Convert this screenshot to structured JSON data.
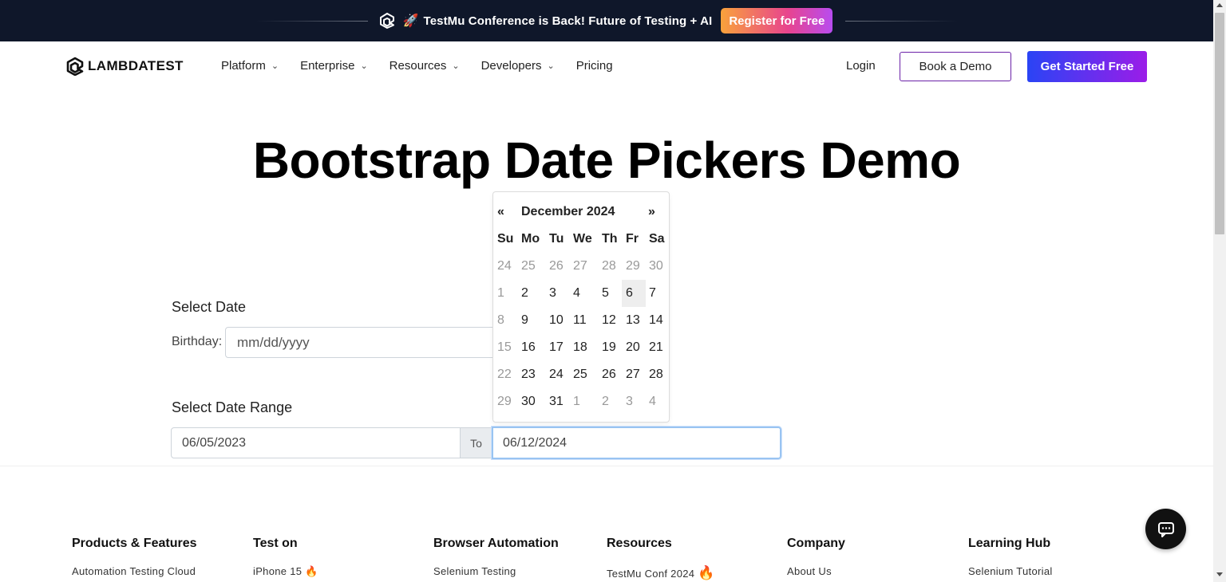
{
  "announcement": {
    "rocket": "🚀",
    "text": "TestMu Conference is Back! Future of Testing + AI",
    "cta": "Register for Free"
  },
  "header": {
    "brand": "LAMBDATEST",
    "nav": [
      {
        "label": "Platform",
        "dropdown": true
      },
      {
        "label": "Enterprise",
        "dropdown": true
      },
      {
        "label": "Resources",
        "dropdown": true
      },
      {
        "label": "Developers",
        "dropdown": true
      },
      {
        "label": "Pricing",
        "dropdown": false
      }
    ],
    "login": "Login",
    "book_demo": "Book a Demo",
    "get_started": "Get Started Free"
  },
  "main": {
    "title": "Bootstrap Date Pickers Demo",
    "select_date_label": "Select Date",
    "birthday_label": "Birthday:",
    "birthday_placeholder": "mm/dd/yyyy",
    "select_range_label": "Select Date Range",
    "range_from": "06/05/2023",
    "range_to_label": "To",
    "range_to": "06/12/2024"
  },
  "datepicker": {
    "prev": "«",
    "title": "December 2024",
    "next": "»",
    "weekdays": [
      "Su",
      "Mo",
      "Tu",
      "We",
      "Th",
      "Fr",
      "Sa"
    ],
    "weeks": [
      [
        {
          "d": "24",
          "old": true
        },
        {
          "d": "25",
          "old": true
        },
        {
          "d": "26",
          "old": true
        },
        {
          "d": "27",
          "old": true
        },
        {
          "d": "28",
          "old": true
        },
        {
          "d": "29",
          "old": true
        },
        {
          "d": "30",
          "old": true
        }
      ],
      [
        {
          "d": "1",
          "old": true
        },
        {
          "d": "2"
        },
        {
          "d": "3"
        },
        {
          "d": "4"
        },
        {
          "d": "5"
        },
        {
          "d": "6",
          "highlight": true
        },
        {
          "d": "7"
        }
      ],
      [
        {
          "d": "8",
          "old": true
        },
        {
          "d": "9"
        },
        {
          "d": "10"
        },
        {
          "d": "11"
        },
        {
          "d": "12"
        },
        {
          "d": "13"
        },
        {
          "d": "14"
        }
      ],
      [
        {
          "d": "15",
          "old": true
        },
        {
          "d": "16"
        },
        {
          "d": "17"
        },
        {
          "d": "18"
        },
        {
          "d": "19"
        },
        {
          "d": "20"
        },
        {
          "d": "21"
        }
      ],
      [
        {
          "d": "22",
          "old": true
        },
        {
          "d": "23"
        },
        {
          "d": "24"
        },
        {
          "d": "25"
        },
        {
          "d": "26"
        },
        {
          "d": "27"
        },
        {
          "d": "28"
        }
      ],
      [
        {
          "d": "29",
          "old": true
        },
        {
          "d": "30"
        },
        {
          "d": "31"
        },
        {
          "d": "1",
          "old": true
        },
        {
          "d": "2",
          "old": true
        },
        {
          "d": "3",
          "old": true
        },
        {
          "d": "4",
          "old": true
        }
      ]
    ]
  },
  "footer": {
    "columns": [
      {
        "heading": "Products & Features",
        "first_link": "Automation Testing Cloud"
      },
      {
        "heading": "Test on",
        "first_link": "iPhone 15",
        "badge": "🔥"
      },
      {
        "heading": "Browser Automation",
        "first_link": "Selenium Testing"
      },
      {
        "heading": "Resources",
        "first_link": "TestMu Conf 2024",
        "badge": "🔥"
      },
      {
        "heading": "Company",
        "first_link": "About Us"
      },
      {
        "heading": "Learning Hub",
        "first_link": "Selenium Tutorial"
      }
    ]
  },
  "colors": {
    "topbar_bg": "#0f172a",
    "register_gradient": [
      "#f9a23b",
      "#e8448e",
      "#b84cf0"
    ],
    "cta_gradient": [
      "#2a44f5",
      "#9b1de8"
    ],
    "demo_border": "#6b21a8",
    "focus_ring": "#99c4f2"
  },
  "icons": {
    "brand_logo": "lambdatest-logo-icon",
    "chat": "chat-icon",
    "chevron": "chevron-down-icon"
  }
}
